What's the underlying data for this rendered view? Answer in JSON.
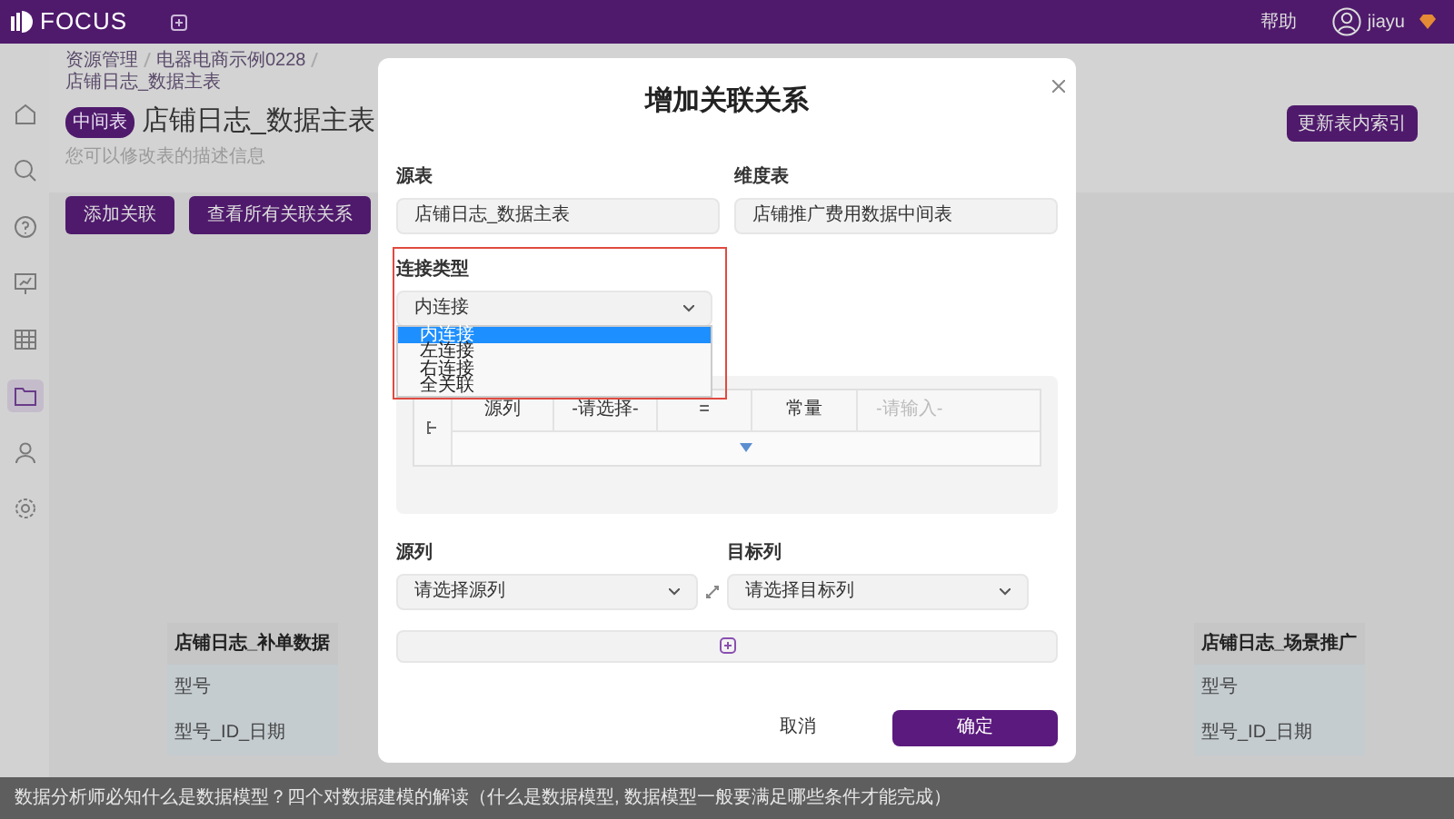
{
  "app": {
    "logo": "FOCUS",
    "help": "帮助",
    "user": "jiayu"
  },
  "sidebar": {
    "items": [
      {
        "selected": false
      },
      {
        "selected": false
      },
      {
        "selected": false
      },
      {
        "selected": false
      },
      {
        "selected": false
      },
      {
        "selected": true
      },
      {
        "selected": false
      },
      {
        "selected": false
      }
    ]
  },
  "breadcrumb": [
    "资源管理",
    "电器电商示例0228",
    "店铺日志_数据主表"
  ],
  "page": {
    "badge": "中间表",
    "title": "店铺日志_数据主表",
    "subtitle": "您可以修改表的描述信息",
    "buttons": [
      "添加关联",
      "查看所有关联关系"
    ],
    "update_button": "更新表内索引"
  },
  "nodes": [
    {
      "title": "店铺日志_补单数据",
      "fields": [
        "型号",
        "型号_ID_日期"
      ]
    },
    {
      "title": "店铺日志_场景推广",
      "fields": [
        "型号",
        "型号_ID_日期"
      ]
    }
  ],
  "modal": {
    "title": "增加关联关系",
    "source_table": {
      "label": "源表",
      "value": "店铺日志_数据主表"
    },
    "dimension_table": {
      "label": "维度表",
      "value": "店铺推广费用数据中间表"
    },
    "join_type": {
      "label": "连接类型",
      "value": "内连接",
      "options": [
        {
          "label": "内连接",
          "selected": true
        },
        {
          "label": "左连接",
          "selected": false
        },
        {
          "label": "右连接",
          "selected": false
        },
        {
          "label": "全关联",
          "selected": false
        }
      ]
    },
    "filter": {
      "cells": [
        "源列",
        "-请选择-",
        "=",
        "常量"
      ],
      "placeholder": "-请输入-"
    },
    "source_column": {
      "label": "源列",
      "value": "请选择源列"
    },
    "target_column": {
      "label": "目标列",
      "value": "请选择目标列"
    },
    "cancel": "取消",
    "confirm": "确定"
  },
  "caption": "数据分析师必知什么是数据模型？四个对数据建模的解读（什么是数据模型, 数据模型一般要满足哪些条件才能完成）"
}
